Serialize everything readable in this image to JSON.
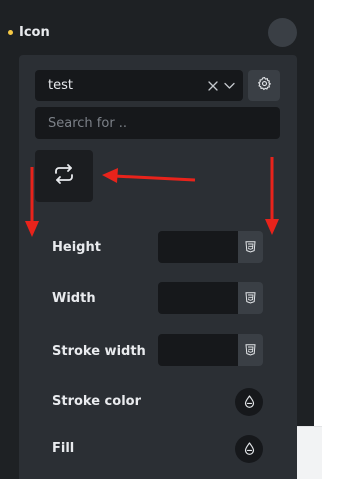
{
  "header": {
    "label": "Icon"
  },
  "icon_control": {
    "selected_value": "test",
    "search_placeholder": "Search for .."
  },
  "fields": [
    {
      "label": "Height",
      "value": ""
    },
    {
      "label": "Width",
      "value": ""
    },
    {
      "label": "Stroke width",
      "value": ""
    }
  ],
  "colors": [
    {
      "label": "Stroke color"
    },
    {
      "label": "Fill"
    }
  ],
  "palette": {
    "accent_dot": "#f6c945",
    "annotation_arrow": "#e8231b"
  },
  "icons": {
    "clear": "close-icon",
    "dropdown": "chevron-down-icon",
    "settings": "gear-icon",
    "preview": "repeat-icon",
    "unit": "css3-icon",
    "color": "droplet-icon"
  }
}
